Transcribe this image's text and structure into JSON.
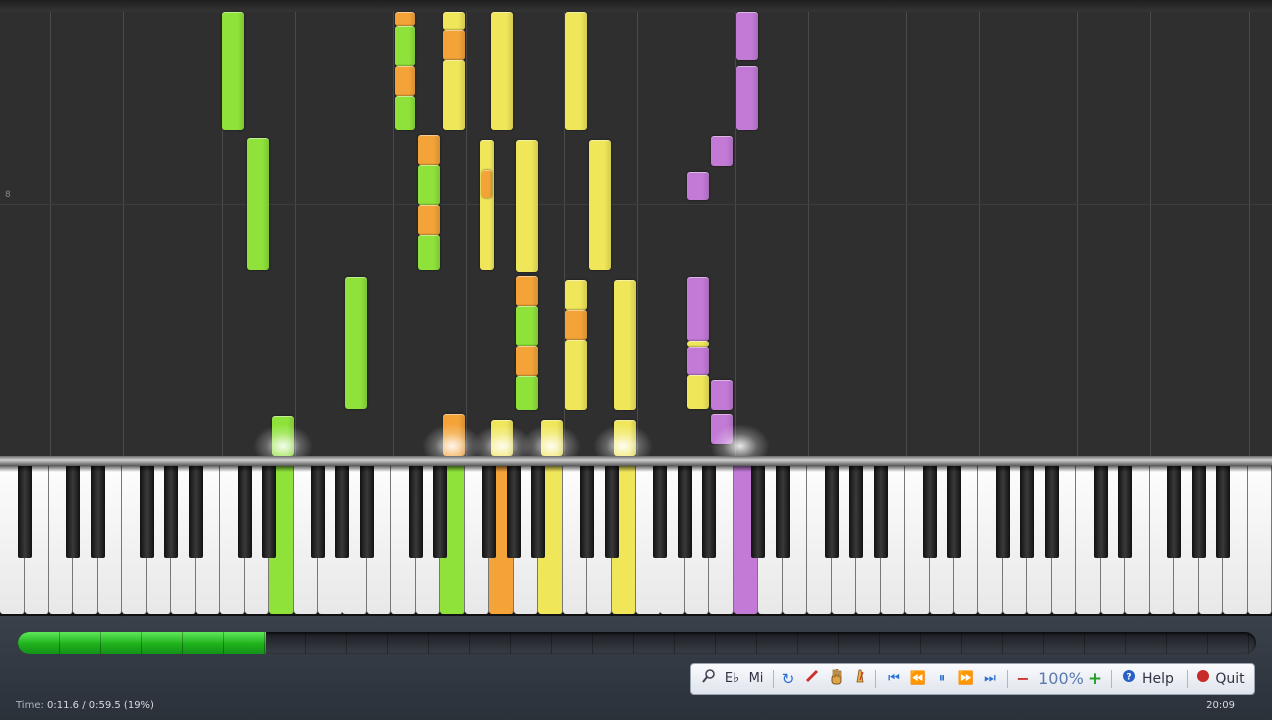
{
  "measure_marker": "8",
  "toolbar": {
    "search_icon": "magnifier-icon",
    "e_label": "E♭",
    "mi_label": "Mi",
    "zoom": "100%",
    "minus": "−",
    "plus": "+",
    "help_label": "Help",
    "quit_label": "Quit"
  },
  "status": {
    "time_label": "Time:",
    "time_value": "0:11.6 / 0:59.5 (19%)",
    "clock": "20:09"
  },
  "progress": {
    "fraction": 0.19
  },
  "colors": {
    "green": "#8fe23a",
    "orange": "#f4a338",
    "yellow": "#f0e65a",
    "purple": "#c27ad6"
  }
}
